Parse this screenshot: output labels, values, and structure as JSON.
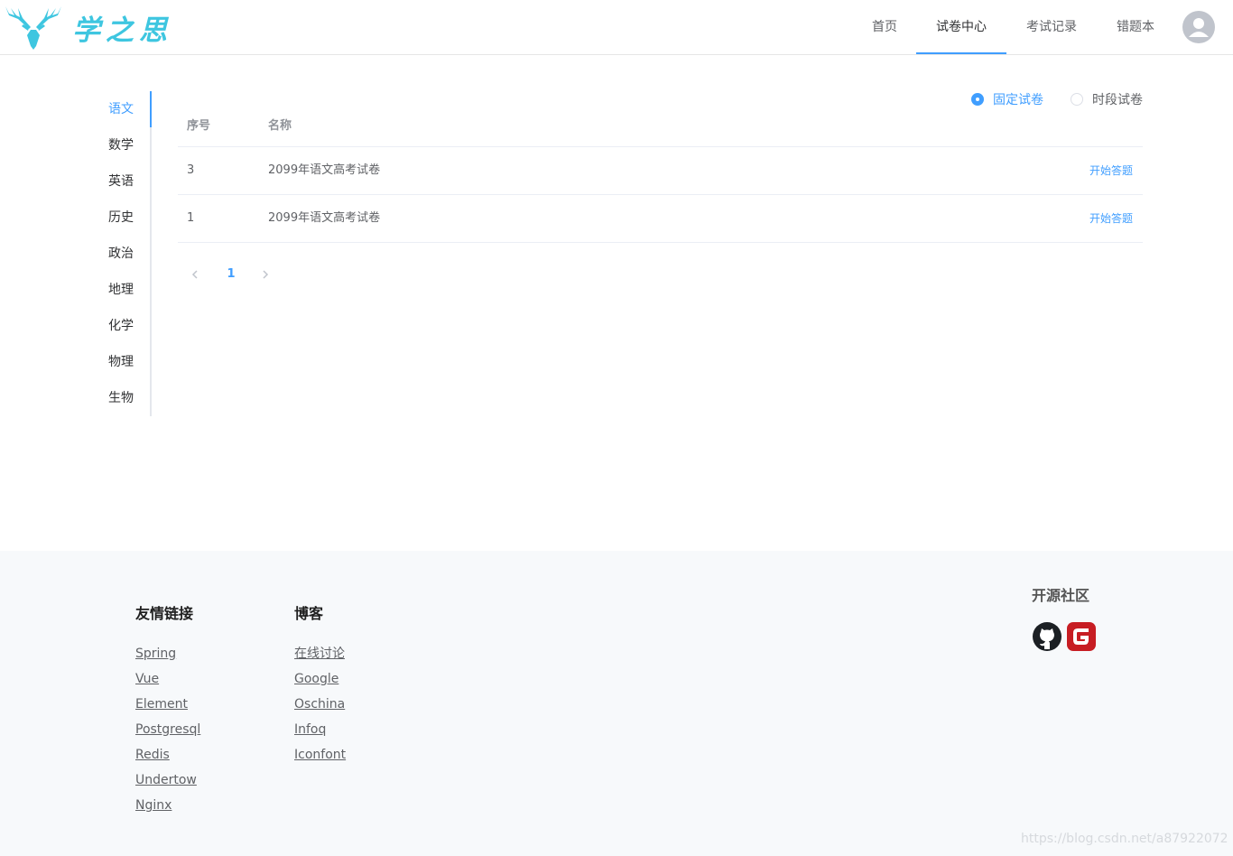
{
  "header": {
    "logo_text": "学之思",
    "nav": [
      {
        "label": "首页",
        "active": false
      },
      {
        "label": "试卷中心",
        "active": true
      },
      {
        "label": "考试记录",
        "active": false
      },
      {
        "label": "错题本",
        "active": false
      }
    ]
  },
  "subjects": [
    {
      "label": "语文",
      "active": true
    },
    {
      "label": "数学",
      "active": false
    },
    {
      "label": "英语",
      "active": false
    },
    {
      "label": "历史",
      "active": false
    },
    {
      "label": "政治",
      "active": false
    },
    {
      "label": "地理",
      "active": false
    },
    {
      "label": "化学",
      "active": false
    },
    {
      "label": "物理",
      "active": false
    },
    {
      "label": "生物",
      "active": false
    }
  ],
  "paper_type": {
    "options": [
      {
        "label": "固定试卷",
        "checked": true
      },
      {
        "label": "时段试卷",
        "checked": false
      }
    ]
  },
  "table": {
    "headers": {
      "index": "序号",
      "name": "名称"
    },
    "rows": [
      {
        "index": "3",
        "name": "2099年语文高考试卷",
        "action": "开始答题"
      },
      {
        "index": "1",
        "name": "2099年语文高考试卷",
        "action": "开始答题"
      }
    ]
  },
  "pagination": {
    "current_page": "1"
  },
  "footer": {
    "links_title": "友情链接",
    "links": [
      "Spring",
      "Vue",
      "Element",
      "Postgresql",
      "Redis",
      "Undertow",
      "Nginx"
    ],
    "blog_title": "博客",
    "blogs": [
      "在线讨论",
      "Google",
      "Oschina",
      "Infoq",
      "Iconfont"
    ],
    "community_title": "开源社区",
    "watermark": "https://blog.csdn.net/a87922072"
  },
  "colors": {
    "accent": "#409eff",
    "logo": "#3ec6e0",
    "gitee_red": "#c71d23"
  }
}
